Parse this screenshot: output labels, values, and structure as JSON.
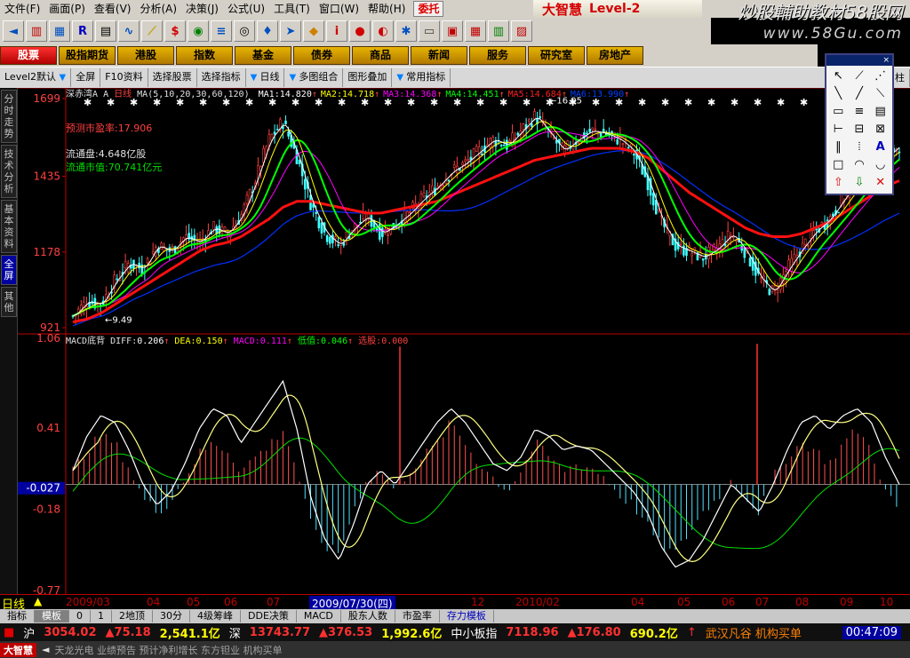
{
  "menu": [
    "文件(F)",
    "画面(P)",
    "查看(V)",
    "分析(A)",
    "决策(J)",
    "公式(U)",
    "工具(T)",
    "窗口(W)",
    "帮助(H)"
  ],
  "weituo_label": "委托",
  "logo": {
    "main": "大智慧",
    "level": "Level-2"
  },
  "watermark": {
    "line1": "炒股輔助教材58股网",
    "line2": "www.58Gu.com"
  },
  "toolbar_icons": [
    "back-icon",
    "candle-chart-icon",
    "grid-icon",
    "rsi-icon",
    "table-icon",
    "indicator-icon",
    "ruler-icon",
    "dollar-icon",
    "eye-icon",
    "lines-icon",
    "binoculars-icon",
    "bell-icon",
    "pointer-icon",
    "radio-icon",
    "info-icon",
    "circle-icon",
    "disc-icon",
    "gear-icon",
    "screen-icon",
    "window-icon",
    "calendar-icon",
    "book-icon",
    "chart-icon"
  ],
  "nav_tabs": [
    "股票",
    "股指期货",
    "港股",
    "指数",
    "基金",
    "债券",
    "商品",
    "新闻",
    "服务",
    "研究室",
    "房地产"
  ],
  "subbar": {
    "level2": "Level2默认",
    "items": [
      "全屏",
      "F10资料",
      "选择股票",
      "选择指标",
      "日线",
      "多图组合",
      "图形叠加",
      "常用指标"
    ],
    "right": [
      "标",
      "权",
      "柱"
    ]
  },
  "left_tabs": [
    "分时走势",
    "技术分析",
    "基本资料",
    "全屏",
    "其他"
  ],
  "main_chart": {
    "stock": "深赤湾A",
    "period": "日线",
    "ma_params": "MA(5,10,20,30,60,120)",
    "ma_values": [
      {
        "name": "MA1",
        "value": "14.820",
        "color": "#ffffff"
      },
      {
        "name": "MA2",
        "value": "14.718",
        "color": "#ffff00"
      },
      {
        "name": "MA3",
        "value": "14.368",
        "color": "#ff00ff"
      },
      {
        "name": "MA4",
        "value": "14.451",
        "color": "#00ff00"
      },
      {
        "name": "MA5",
        "value": "14.684",
        "color": "#ff2020"
      },
      {
        "name": "MA6",
        "value": "13.990",
        "color": "#0040ff"
      }
    ],
    "ytick_labels": [
      "1699",
      "1435",
      "1178",
      "921"
    ],
    "peak_label": "16.95",
    "low_label": "9.49",
    "pe": "预测市盈率:17.906",
    "float_shares": "流通盘:4.648亿股",
    "float_value": "流通市值:70.741亿元"
  },
  "macd": {
    "title": "MACD底背",
    "diff": "0.206",
    "dea": "0.150",
    "macd_val": "0.111",
    "low_label": "低值",
    "low": "0.046",
    "sel_label": "选股",
    "sel": "0.000",
    "ytick_labels": [
      "1.06",
      "0.41",
      "-0.027",
      "-0.18",
      "-0.77"
    ]
  },
  "date_axis": [
    "2009/03",
    "04",
    "05",
    "06",
    "07",
    "2009/07/30(四)",
    "12",
    "2010/02",
    "04",
    "05",
    "06",
    "07",
    "08",
    "09",
    "10"
  ],
  "period_bar": [
    "指标",
    "模板",
    "0",
    "1",
    "2地顶",
    "30分",
    "4级筹峰",
    "DDE决策",
    "MACD",
    "股东人数",
    "市盈率",
    "存力模板"
  ],
  "status": {
    "sh_label": "沪",
    "sh_index": "3054.02",
    "sh_change": "▲75.18",
    "sh_amount": "2,541.1亿",
    "sz_label": "深",
    "sz_index": "13743.77",
    "sz_change": "▲376.53",
    "sz_amount": "1,992.6亿",
    "sme_label": "中小板指",
    "sme_index": "7118.96",
    "sme_change": "▲176.80",
    "sme_amount": "690.2亿",
    "ticker": "武汉凡谷 机构买单",
    "time": "00:47:09"
  },
  "footer": {
    "logo": "大智慧",
    "ticker": "天龙光电 业绩预告 预计净利增长 东方钽业 机构买单"
  },
  "chart_data": [
    {
      "type": "candlestick",
      "title": "深赤湾A 日线",
      "ylim": [
        9.21,
        16.99
      ],
      "series": [
        {
          "name": "Close",
          "values": [
            9.6,
            10.1,
            10.0,
            10.8,
            11.4,
            11.2,
            12.0,
            11.8,
            12.3,
            12.1,
            12.6,
            12.4,
            13.0,
            14.2,
            15.6,
            16.2,
            15.0,
            13.4,
            12.4,
            12.0,
            12.6,
            13.0,
            12.4,
            12.7,
            13.1,
            13.6,
            14.0,
            14.5,
            14.8,
            15.2,
            15.6,
            15.4,
            15.9,
            16.4,
            15.8,
            15.2,
            15.6,
            15.9,
            15.8,
            15.6,
            15.2,
            14.2,
            12.8,
            12.0,
            11.8,
            11.6,
            11.9,
            12.4,
            11.8,
            10.9,
            10.4,
            11.2,
            11.9,
            12.5,
            12.9,
            13.6,
            14.2,
            14.7,
            15.0,
            15.4
          ]
        },
        {
          "name": "MA(slow)",
          "values": [
            9.4,
            9.5,
            9.7,
            10.0,
            10.3,
            10.6,
            10.9,
            11.2,
            11.5,
            11.8,
            12.0,
            12.1,
            12.3,
            12.6,
            12.9,
            13.3,
            13.5,
            13.5,
            13.4,
            13.3,
            13.2,
            13.1,
            13.1,
            13.2,
            13.3,
            13.4,
            13.5,
            13.7,
            13.9,
            14.1,
            14.3,
            14.5,
            14.7,
            14.9,
            15.0,
            15.1,
            15.2,
            15.3,
            15.3,
            15.3,
            15.2,
            15.0,
            14.6,
            14.2,
            13.8,
            13.5,
            13.2,
            12.9,
            12.6,
            12.4,
            12.3,
            12.3,
            12.4,
            12.6,
            12.8,
            13.1,
            13.4,
            13.7,
            14.0,
            14.2
          ]
        }
      ]
    },
    {
      "type": "bar",
      "title": "MACD",
      "ylim": [
        -0.77,
        1.06
      ],
      "series": [
        {
          "name": "MACD",
          "values": [
            0.1,
            0.25,
            0.35,
            0.3,
            0.12,
            -0.1,
            -0.2,
            -0.12,
            0.05,
            0.22,
            0.3,
            0.25,
            0.1,
            0.2,
            0.28,
            0.4,
            0.1,
            -0.3,
            -0.45,
            -0.5,
            -0.2,
            0.05,
            0.1,
            -0.05,
            0.1,
            0.2,
            0.3,
            0.45,
            0.3,
            0.15,
            0.05,
            -0.05,
            0.1,
            0.3,
            0.2,
            0.1,
            0.15,
            0.12,
            0.05,
            -0.08,
            -0.15,
            -0.3,
            -0.45,
            -0.5,
            -0.35,
            -0.2,
            -0.1,
            0.05,
            -0.1,
            -0.2,
            0.05,
            0.2,
            0.3,
            0.25,
            0.15,
            0.3,
            0.4,
            0.25,
            -0.05,
            -0.2
          ]
        },
        {
          "name": "DIFF",
          "values": [
            0.1,
            0.35,
            0.5,
            0.45,
            0.25,
            0.0,
            -0.15,
            -0.05,
            0.15,
            0.4,
            0.55,
            0.5,
            0.3,
            0.45,
            0.6,
            0.75,
            0.4,
            -0.1,
            -0.4,
            -0.55,
            -0.3,
            0.0,
            0.1,
            0.0,
            0.15,
            0.3,
            0.45,
            0.55,
            0.45,
            0.3,
            0.15,
            0.1,
            0.2,
            0.4,
            0.35,
            0.25,
            0.28,
            0.25,
            0.15,
            0.05,
            -0.05,
            -0.2,
            -0.45,
            -0.6,
            -0.55,
            -0.4,
            -0.2,
            0.0,
            -0.1,
            -0.2,
            0.0,
            0.25,
            0.45,
            0.5,
            0.4,
            0.5,
            0.55,
            0.45,
            0.2,
            0.0
          ]
        }
      ]
    }
  ]
}
